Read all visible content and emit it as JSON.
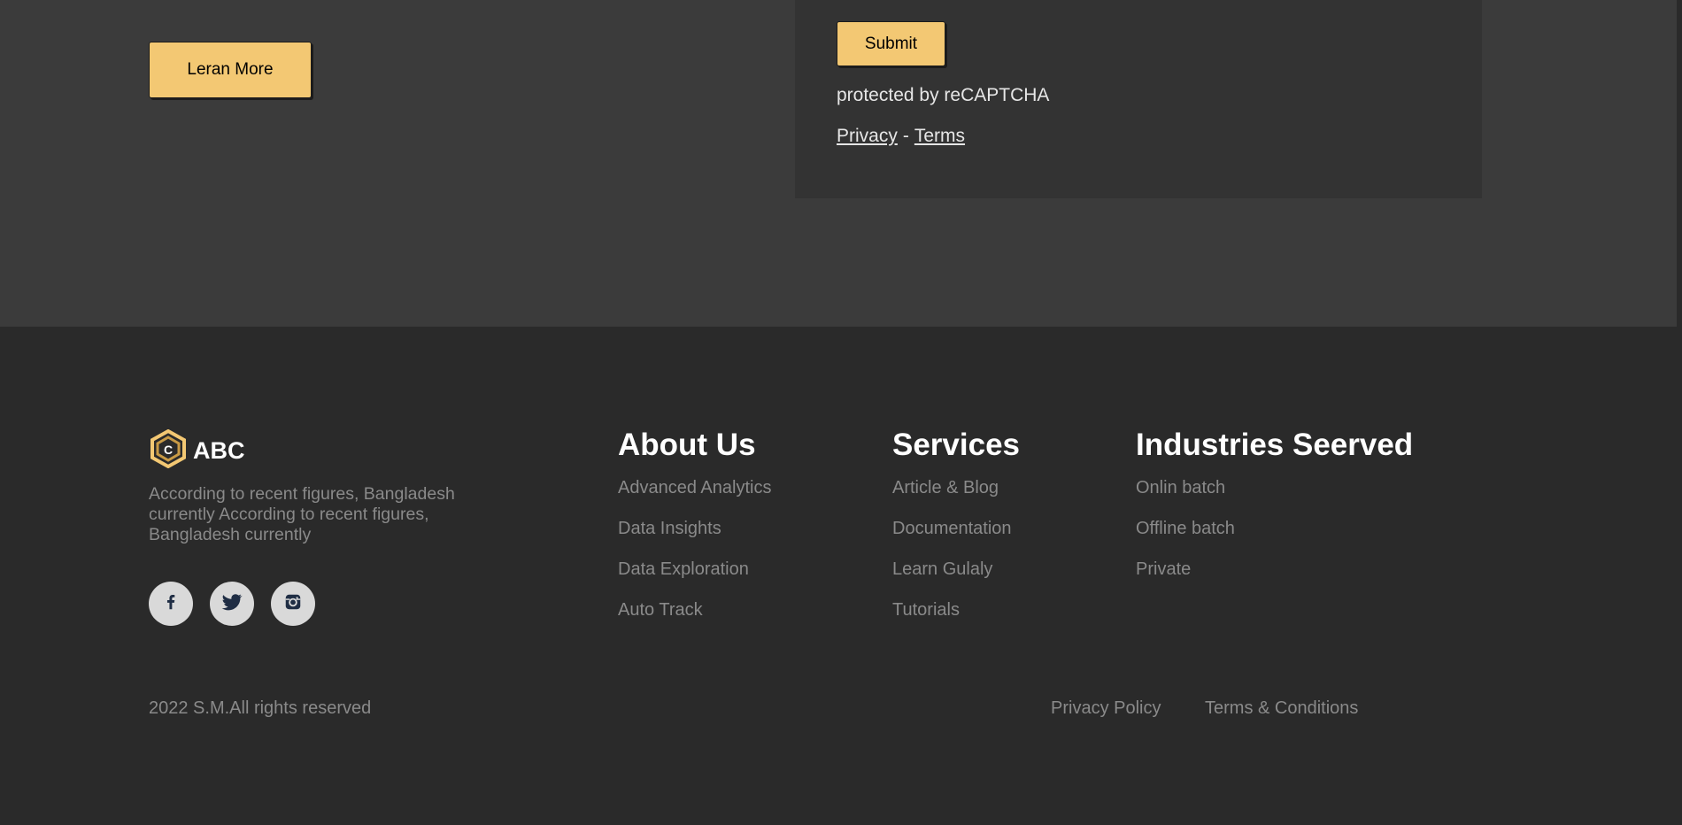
{
  "hero": {
    "learn_more_label": "Leran More"
  },
  "form": {
    "submit_label": "Submit",
    "recaptcha_text": "protected by reCAPTCHA",
    "privacy_label": "Privacy",
    "separator": "-",
    "terms_label": "Terms"
  },
  "footer": {
    "brand": "ABC",
    "blurb": "According to recent figures, Bangladesh currently According to recent figures, Bangladesh currently",
    "social": [
      {
        "icon": "facebook-icon"
      },
      {
        "icon": "twitter-icon"
      },
      {
        "icon": "instagram-icon"
      }
    ],
    "about": {
      "title": "About Us",
      "items": [
        "Advanced Analytics",
        "Data Insights",
        "Data Exploration",
        "Auto Track"
      ]
    },
    "services": {
      "title": "Services",
      "items": [
        "Article & Blog",
        "Documentation",
        "Learn Gulaly",
        "Tutorials"
      ]
    },
    "industries": {
      "title": "Industries Seerved",
      "items": [
        "Onlin batch",
        "Offline batch",
        "Private"
      ]
    },
    "copyright": "2022 S.M.All rights reserved",
    "privacy_policy": "Privacy Policy",
    "terms_conditions": "Terms & Conditions"
  },
  "colors": {
    "accent": "#f3c873",
    "upper_bg": "#3b3b3b",
    "card_bg": "#333333",
    "footer_bg": "#2a2a2a",
    "muted_text": "#8a8a8a"
  }
}
